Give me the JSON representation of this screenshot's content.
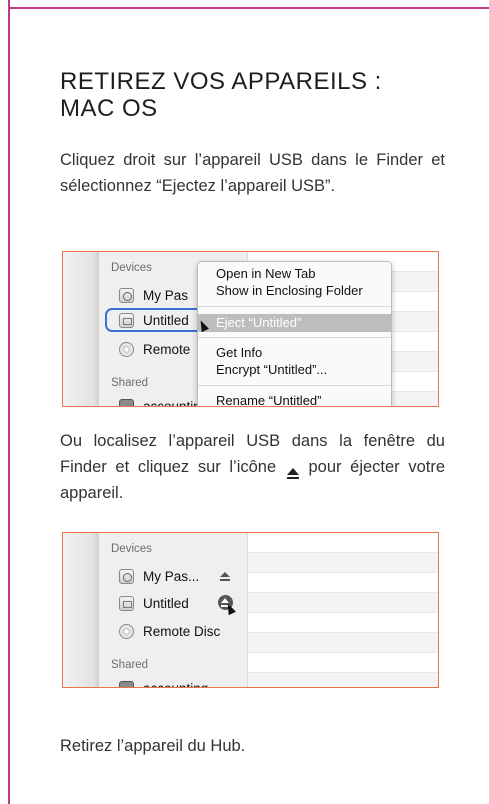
{
  "heading": {
    "line1": "RETIREZ VOS APPAREILS :",
    "line2": "MAC OS"
  },
  "paragraphs": {
    "p1": "Cliquez droit sur l’appareil USB dans le Finder et sélectionnez “Ejectez l’appareil USB”.",
    "p2_before": "Ou localisez l’appareil USB dans la fenêtre du Finder et cliquez sur l’icône",
    "p2_after": "pour éjecter votre appareil.",
    "p3": "Retirez l’appareil du Hub."
  },
  "screenshot1": {
    "devices_label": "Devices",
    "items": [
      "My Pas",
      "Untitled",
      "Remote"
    ],
    "shared_label": "Shared",
    "shared_item": "accounting",
    "menu": {
      "open_new_tab": "Open in New Tab",
      "show_enclosing": "Show in Enclosing Folder",
      "eject": "Eject “Untitled”",
      "get_info": "Get Info",
      "encrypt": "Encrypt “Untitled”...",
      "rename": "Rename “Untitled”"
    }
  },
  "screenshot2": {
    "devices_label": "Devices",
    "items": [
      "My Pas...",
      "Untitled",
      "Remote Disc"
    ],
    "shared_label": "Shared",
    "shared_item": "accounting"
  },
  "colors": {
    "frame": "#c0398a",
    "screenshot_border": "#e8734f",
    "selection_outline": "#3a6fd8"
  },
  "icons": [
    "clock-disk-icon",
    "disk-icon",
    "cd-icon",
    "network-icon",
    "eject-icon",
    "cursor-icon"
  ]
}
